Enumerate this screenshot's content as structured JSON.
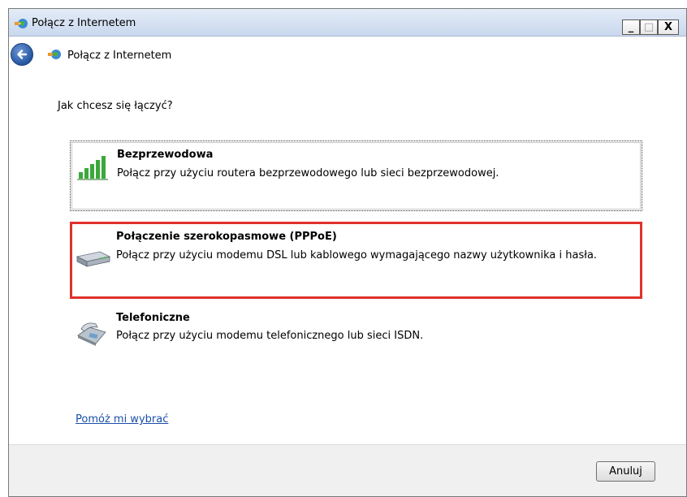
{
  "window": {
    "title": "Połącz z Internetem",
    "controls": {
      "minimize": "_",
      "maximize": "□",
      "close": "X"
    }
  },
  "nav": {
    "title": "Połącz z Internetem"
  },
  "question": "Jak chcesz się łączyć?",
  "options": [
    {
      "title": "Bezprzewodowa",
      "description": "Połącz przy użyciu routera bezprzewodowego lub sieci bezprzewodowej.",
      "icon": "wireless-signal-icon"
    },
    {
      "title": "Połączenie szerokopasmowe (PPPoE)",
      "description": "Połącz przy użyciu modemu DSL lub kablowego wymagającego nazwy użytkownika i hasła.",
      "icon": "broadband-modem-icon",
      "highlight_color": "#e0312c"
    },
    {
      "title": "Telefoniczne",
      "description": "Połącz przy użyciu modemu telefonicznego lub sieci ISDN.",
      "icon": "dialup-phone-icon"
    }
  ],
  "help_link": "Pomóż mi wybrać",
  "footer": {
    "cancel_label": "Anuluj"
  },
  "colors": {
    "link": "#1a4fa8",
    "highlight": "#e0312c"
  }
}
